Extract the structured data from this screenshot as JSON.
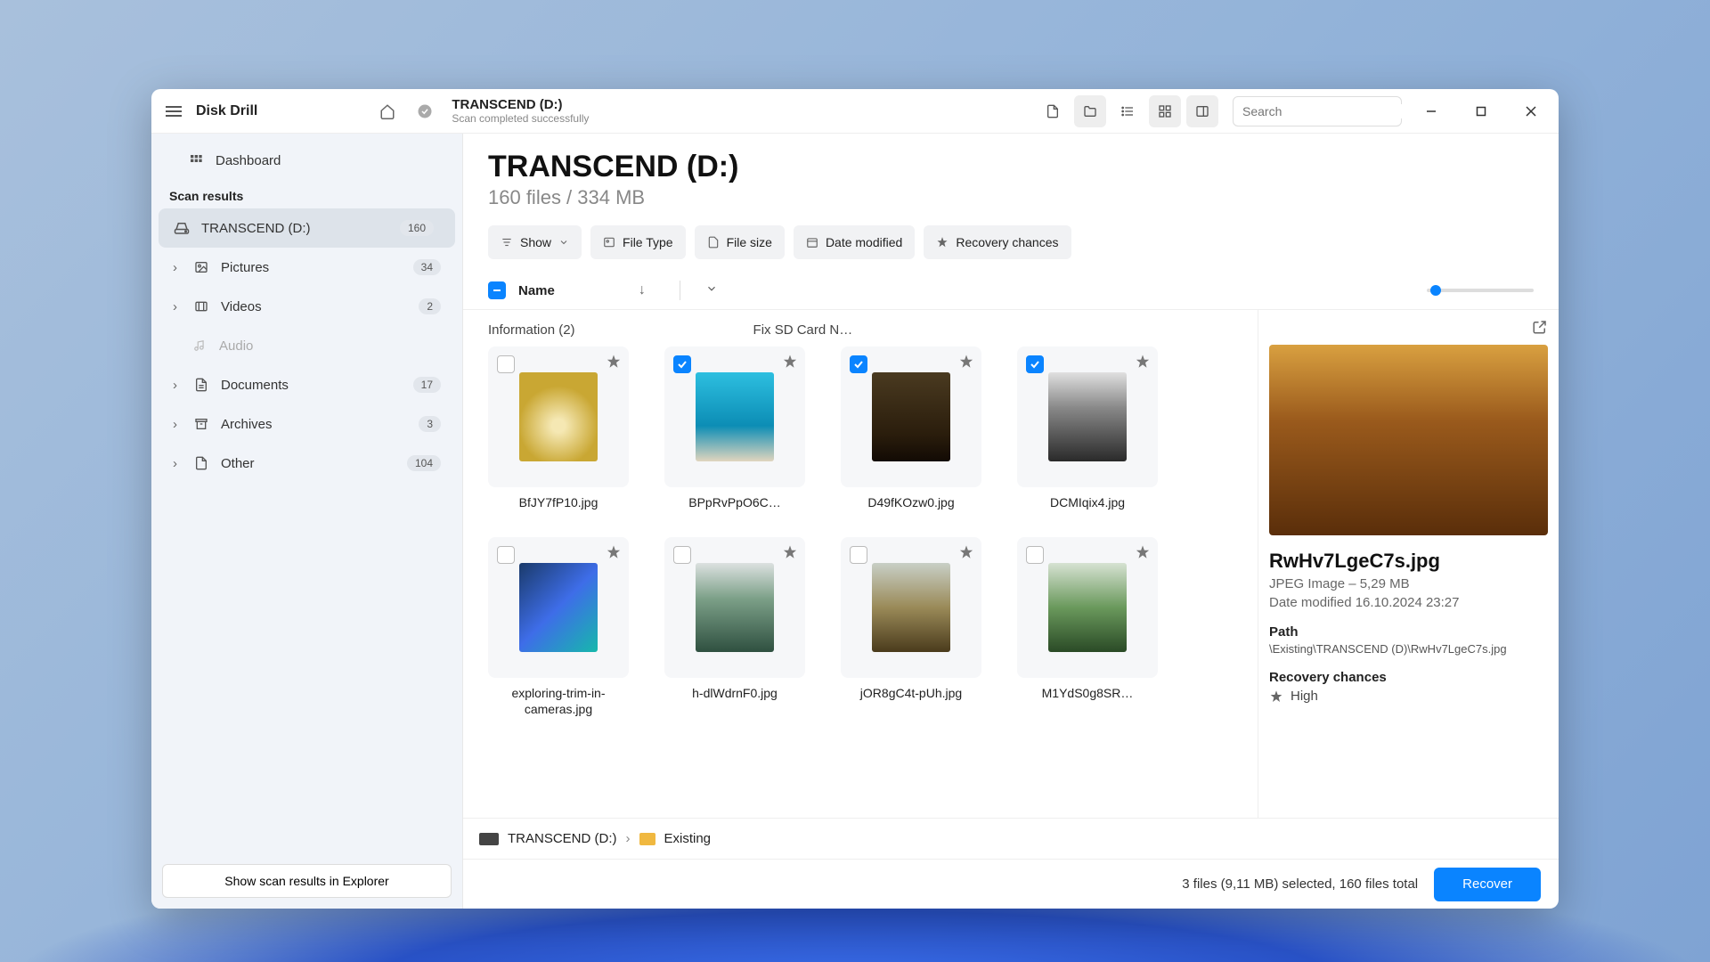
{
  "app": {
    "title": "Disk Drill"
  },
  "titlebar": {
    "location_title": "TRANSCEND (D:)",
    "location_subtitle": "Scan completed successfully",
    "search_placeholder": "Search"
  },
  "sidebar": {
    "dashboard_label": "Dashboard",
    "scan_results_header": "Scan results",
    "items": [
      {
        "label": "TRANSCEND (D:)",
        "badge": "160"
      },
      {
        "label": "Pictures",
        "badge": "34"
      },
      {
        "label": "Videos",
        "badge": "2"
      },
      {
        "label": "Audio",
        "badge": ""
      },
      {
        "label": "Documents",
        "badge": "17"
      },
      {
        "label": "Archives",
        "badge": "3"
      },
      {
        "label": "Other",
        "badge": "104"
      }
    ],
    "footer_button": "Show scan results in Explorer"
  },
  "page": {
    "title": "TRANSCEND (D:)",
    "subtitle": "160 files / 334 MB",
    "filters": {
      "show": "Show",
      "file_type": "File Type",
      "file_size": "File size",
      "date_modified": "Date modified",
      "recovery_chances": "Recovery chances"
    }
  },
  "columns": {
    "name": "Name"
  },
  "groups": [
    {
      "title": "Information (2)"
    },
    {
      "title": "Fix SD Card N…"
    }
  ],
  "files": [
    {
      "name": "BfJY7fP10.jpg",
      "checked": false
    },
    {
      "name": "BPpRvPpO6C…",
      "checked": true
    },
    {
      "name": "D49fKOzw0.jpg",
      "checked": true
    },
    {
      "name": "DCMIqix4.jpg",
      "checked": true
    },
    {
      "name": "exploring-trim-in-cameras.jpg",
      "checked": false
    },
    {
      "name": "h-dlWdrnF0.jpg",
      "checked": false
    },
    {
      "name": "jOR8gC4t-pUh.jpg",
      "checked": false
    },
    {
      "name": "M1YdS0g8SR…",
      "checked": false
    }
  ],
  "preview": {
    "filename": "RwHv7LgeC7s.jpg",
    "type_line": "JPEG Image – 5,29 MB",
    "date_line": "Date modified 16.10.2024 23:27",
    "path_label": "Path",
    "path_value": "\\Existing\\TRANSCEND (D)\\RwHv7LgeC7s.jpg",
    "recovery_label": "Recovery chances",
    "recovery_value": "High"
  },
  "breadcrumb": {
    "drive": "TRANSCEND (D:)",
    "folder": "Existing"
  },
  "footer": {
    "status": "3 files (9,11 MB) selected, 160 files total",
    "recover": "Recover"
  }
}
